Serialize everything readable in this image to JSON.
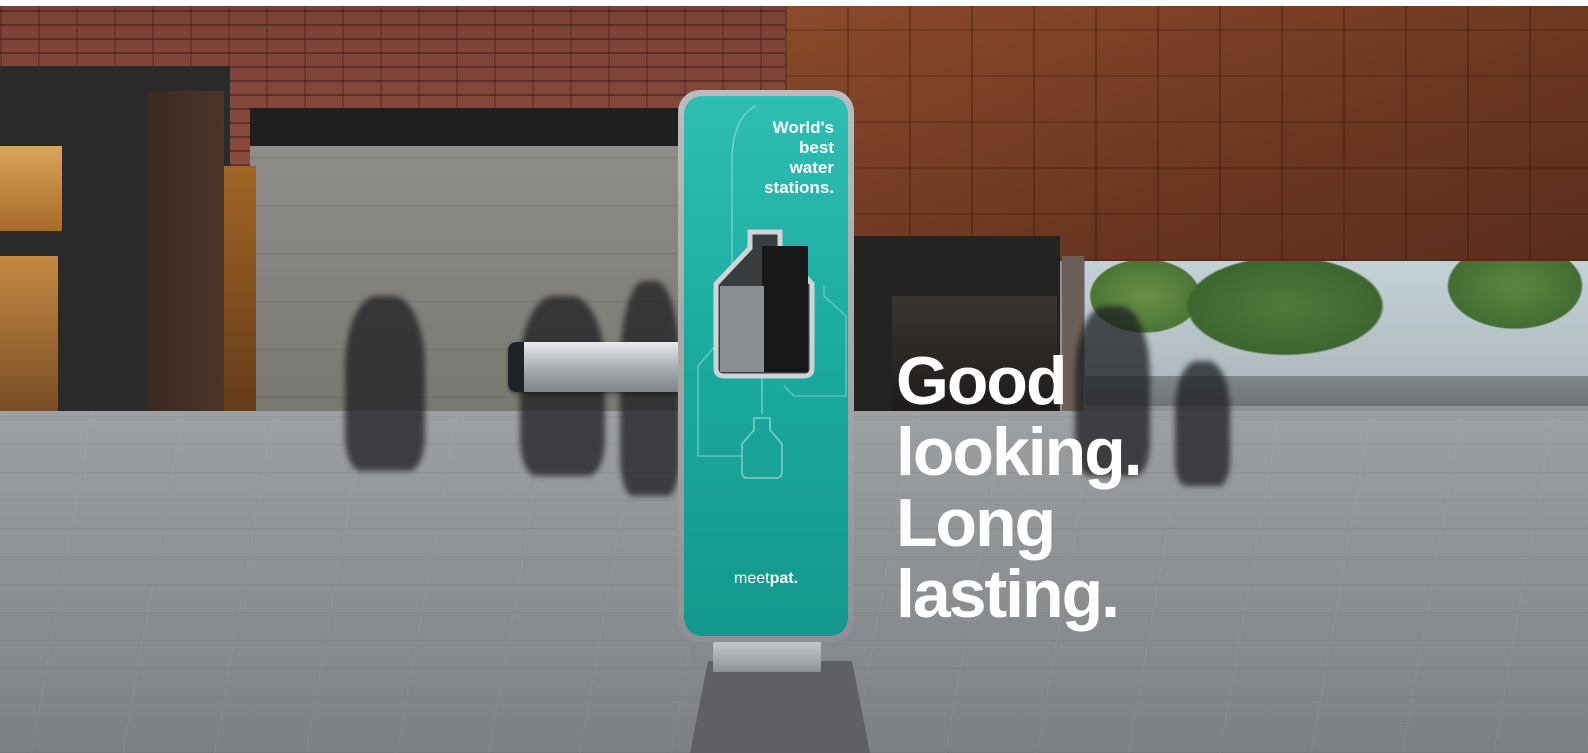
{
  "station": {
    "title": "World's\nbest\nwater\nstations.",
    "logo": {
      "part1": "meet",
      "part2": "pat."
    },
    "color": "#1fb3a9"
  },
  "headline": {
    "lines": [
      "Good",
      "looking.",
      "Long",
      "lasting."
    ]
  }
}
